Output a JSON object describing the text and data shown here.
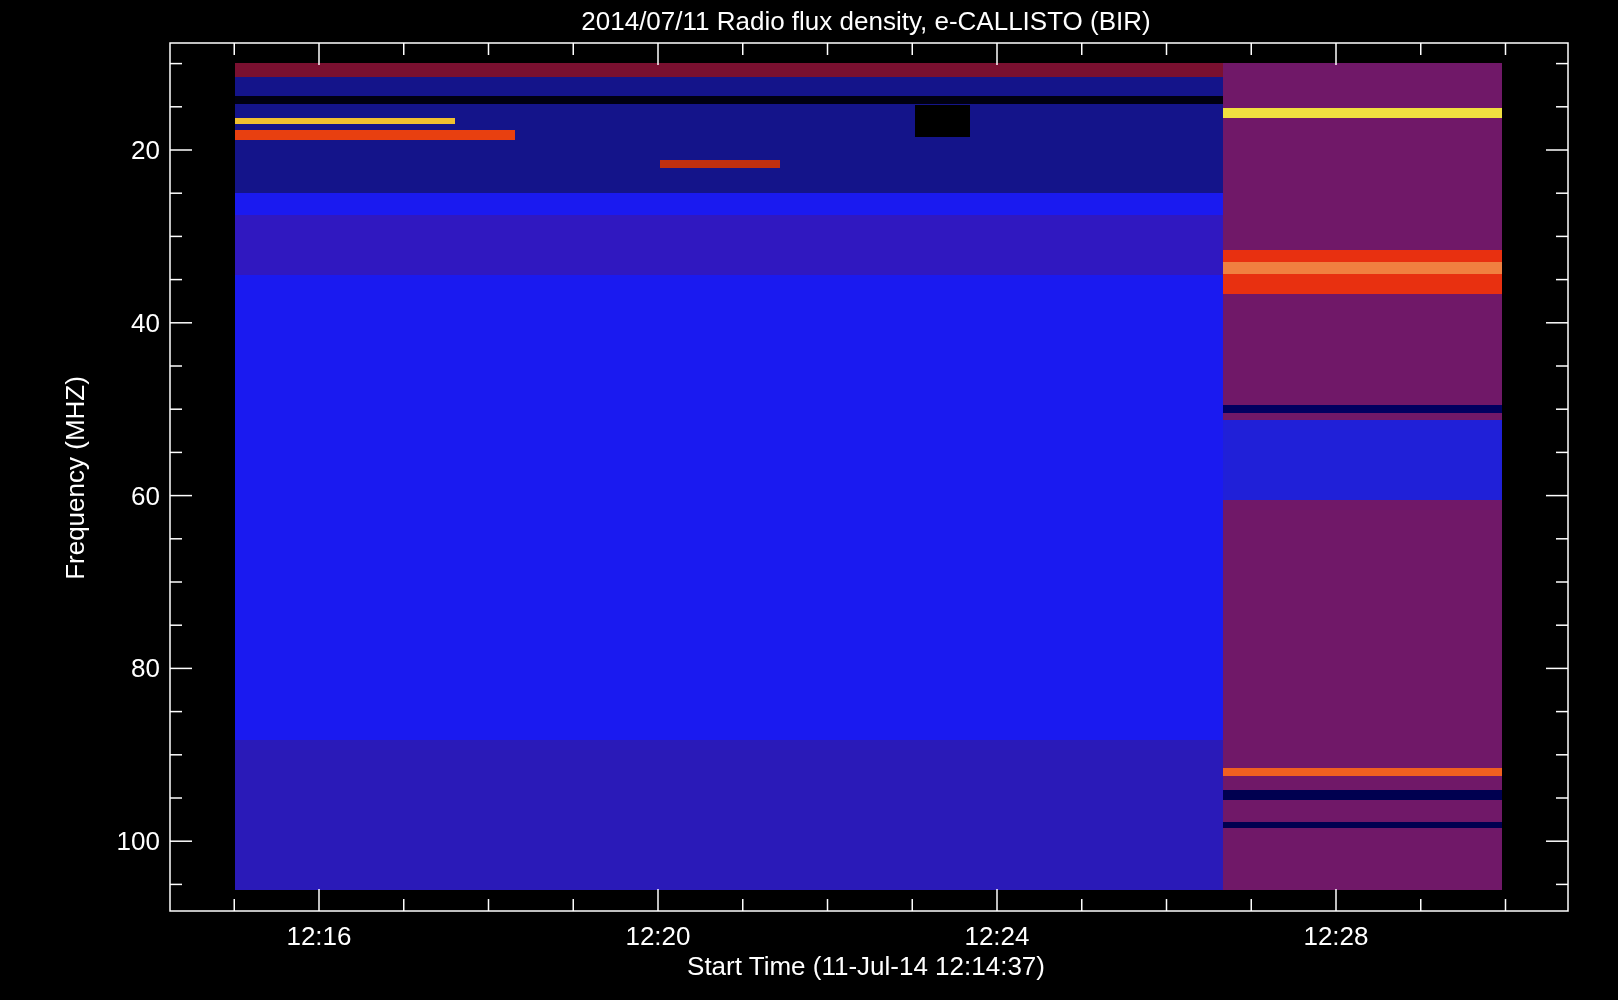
{
  "title": "2014/07/11  Radio flux density, e-CALLISTO (BIR)",
  "y_axis": {
    "label": "Frequency (MHZ)",
    "ticks": [
      "20",
      "40",
      "60",
      "80",
      "100"
    ]
  },
  "x_axis": {
    "label": "Start Time (11-Jul-14 12:14:37)",
    "ticks": [
      "12:16",
      "12:20",
      "12:24",
      "12:28"
    ]
  }
}
